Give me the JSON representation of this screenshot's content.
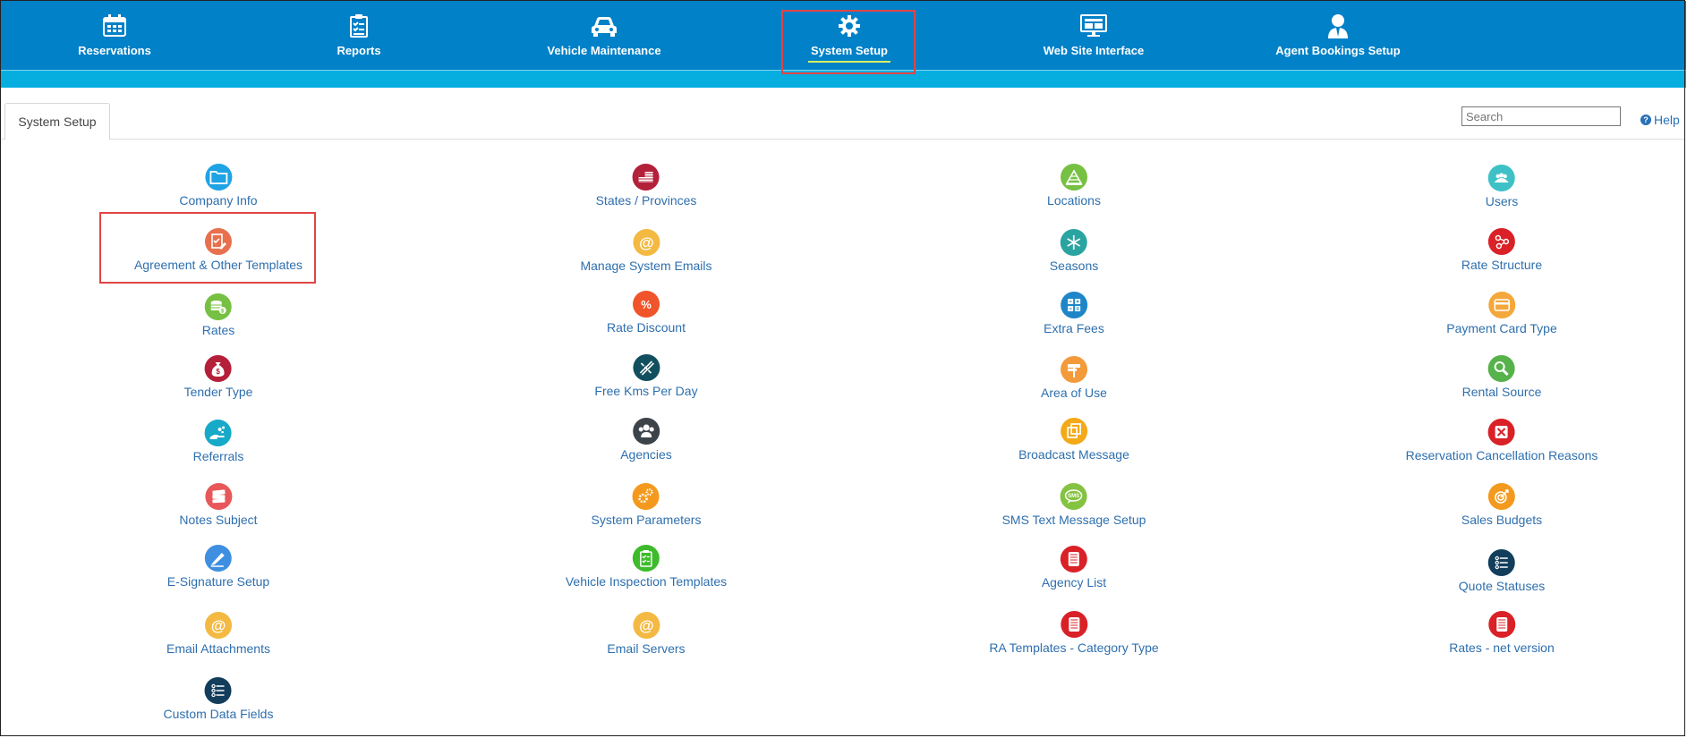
{
  "nav": {
    "items": [
      {
        "label": "Reservations",
        "icon": "calendar-icon"
      },
      {
        "label": "Reports",
        "icon": "checklist-icon"
      },
      {
        "label": "Vehicle Maintenance",
        "icon": "car-icon"
      },
      {
        "label": "System Setup",
        "icon": "gear-icon",
        "active": true
      },
      {
        "label": "Web Site Interface",
        "icon": "monitor-icon"
      },
      {
        "label": "Agent Bookings Setup",
        "icon": "agent-icon"
      }
    ]
  },
  "tab": {
    "label": "System Setup"
  },
  "search": {
    "placeholder": "Search"
  },
  "help": {
    "label": "Help"
  },
  "setup": {
    "columns": [
      {
        "items": [
          {
            "label": "Company Info",
            "icon": "folder-icon",
            "color": "#1ea3e4"
          },
          {
            "label": "Agreement & Other Templates",
            "icon": "edit-document-icon",
            "color": "#e8704e"
          },
          {
            "label": "Rates",
            "icon": "coins-icon",
            "color": "#76c043"
          },
          {
            "label": "Tender Type",
            "icon": "money-bag-icon",
            "color": "#b41f3a"
          },
          {
            "label": "Referrals",
            "icon": "hand-icon",
            "color": "#17a9c8"
          },
          {
            "label": "Notes Subject",
            "icon": "notes-icon",
            "color": "#e8585a"
          },
          {
            "label": "E-Signature Setup",
            "icon": "pen-icon",
            "color": "#3f8fe0"
          },
          {
            "label": "Email Attachments",
            "icon": "at-icon",
            "color": "#f4b942"
          },
          {
            "label": "Custom Data Fields",
            "icon": "list-icon",
            "color": "#123e5c"
          }
        ]
      },
      {
        "items": [
          {
            "label": "States / Provinces",
            "icon": "flag-icon",
            "color": "#b3203a"
          },
          {
            "label": "Manage System Emails",
            "icon": "at-icon",
            "color": "#f4b942"
          },
          {
            "label": "Rate Discount",
            "icon": "percent-icon",
            "color": "#f0542a"
          },
          {
            "label": "Free Kms Per Day",
            "icon": "road-icon",
            "color": "#124f5e"
          },
          {
            "label": "Agencies",
            "icon": "people-icon",
            "color": "#3c4349"
          },
          {
            "label": "System Parameters",
            "icon": "gears-icon",
            "color": "#f39a1e"
          },
          {
            "label": "Vehicle Inspection Templates",
            "icon": "clipboard-icon",
            "color": "#3dbb2b"
          },
          {
            "label": "Email Servers",
            "icon": "at-icon",
            "color": "#f4b942"
          }
        ]
      },
      {
        "items": [
          {
            "label": "Locations",
            "icon": "building-icon",
            "color": "#76c043"
          },
          {
            "label": "Seasons",
            "icon": "snowflake-icon",
            "color": "#2aa4a1"
          },
          {
            "label": "Extra Fees",
            "icon": "calculator-icon",
            "color": "#1e86c8"
          },
          {
            "label": "Area of Use",
            "icon": "signpost-icon",
            "color": "#f39a3a"
          },
          {
            "label": "Broadcast Message",
            "icon": "copy-icon",
            "color": "#f4a918"
          },
          {
            "label": "SMS Text Message Setup",
            "icon": "sms-icon",
            "color": "#84c341"
          },
          {
            "label": "Agency List",
            "icon": "document-icon",
            "color": "#d92127"
          },
          {
            "label": "RA Templates - Category Type",
            "icon": "document-icon",
            "color": "#d92127"
          }
        ]
      },
      {
        "items": [
          {
            "label": "Users",
            "icon": "users-icon",
            "color": "#3ec1c6"
          },
          {
            "label": "Rate Structure",
            "icon": "nodes-icon",
            "color": "#d92127"
          },
          {
            "label": "Payment Card Type",
            "icon": "card-icon",
            "color": "#f4a73a"
          },
          {
            "label": "Rental Source",
            "icon": "magnifier-icon",
            "color": "#56b24a"
          },
          {
            "label": "Reservation Cancellation Reasons",
            "icon": "cancel-icon",
            "color": "#d92127"
          },
          {
            "label": "Sales Budgets",
            "icon": "target-icon",
            "color": "#f39a1e"
          },
          {
            "label": "Quote Statuses",
            "icon": "list-icon",
            "color": "#123e5c"
          },
          {
            "label": "Rates - net version",
            "icon": "document-icon",
            "color": "#d92127"
          }
        ]
      }
    ]
  }
}
